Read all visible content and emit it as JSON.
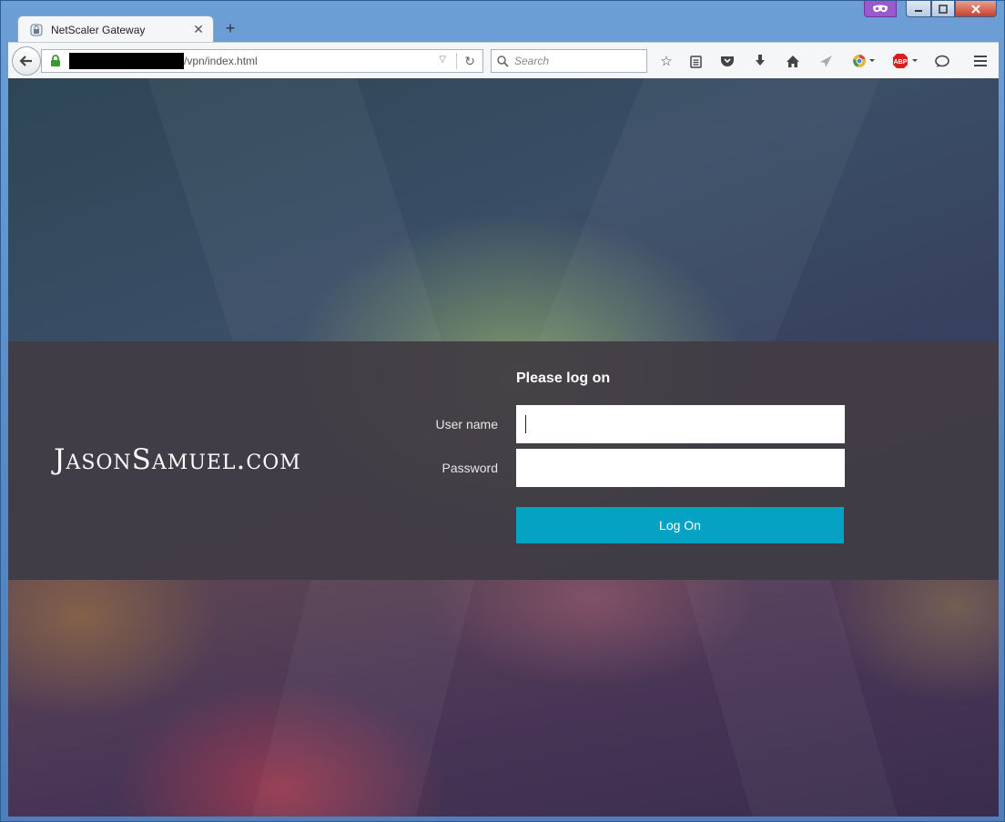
{
  "browser": {
    "tab": {
      "title": "NetScaler Gateway"
    },
    "new_tab_label": "+",
    "url_suffix": "/vpn/index.html",
    "search_placeholder": "Search",
    "toolbar_icons": [
      "bookmark-star-icon",
      "reading-list-icon",
      "pocket-icon",
      "download-icon",
      "home-icon",
      "send-icon",
      "chrome-icon",
      "abp-icon",
      "chat-icon",
      "menu-icon"
    ],
    "abp_label": "ABP"
  },
  "page": {
    "brand": "JasonSamuel.com",
    "form": {
      "heading": "Please log on",
      "username_label": "User name",
      "password_label": "Password",
      "username_value": "",
      "password_value": "",
      "submit_label": "Log On"
    }
  },
  "colors": {
    "button": "#06a2c3",
    "band": "#423c44"
  }
}
